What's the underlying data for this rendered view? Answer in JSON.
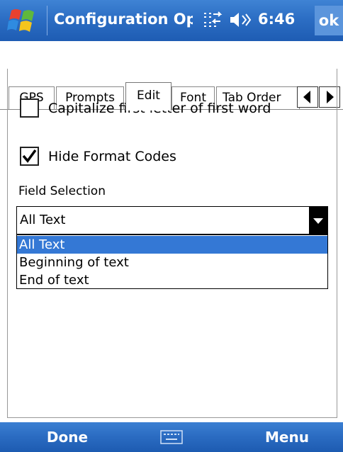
{
  "titlebar": {
    "title": "Configuration Options",
    "time": "6:46",
    "ok_label": "ok"
  },
  "tabs": [
    {
      "label": "GPS",
      "active": false
    },
    {
      "label": "Prompts",
      "active": false
    },
    {
      "label": "Edit",
      "active": true
    },
    {
      "label": "Font",
      "active": false
    },
    {
      "label": "Tab Order",
      "active": false
    }
  ],
  "edit": {
    "capitalize": {
      "label": "Capitalize first letter of first word",
      "checked": false
    },
    "hide_codes": {
      "label": "Hide Format Codes",
      "checked": true
    },
    "field_selection_label": "Field Selection",
    "field_selection_value": "All Text",
    "field_selection_options": [
      "All Text",
      "Beginning of text",
      "End of text"
    ],
    "field_selection_highlighted": "All Text"
  },
  "menubar": {
    "left_softkey": "Done",
    "right_softkey": "Menu"
  },
  "colors": {
    "titlebar": "#2c6ec4",
    "selection": "#3478d5"
  }
}
